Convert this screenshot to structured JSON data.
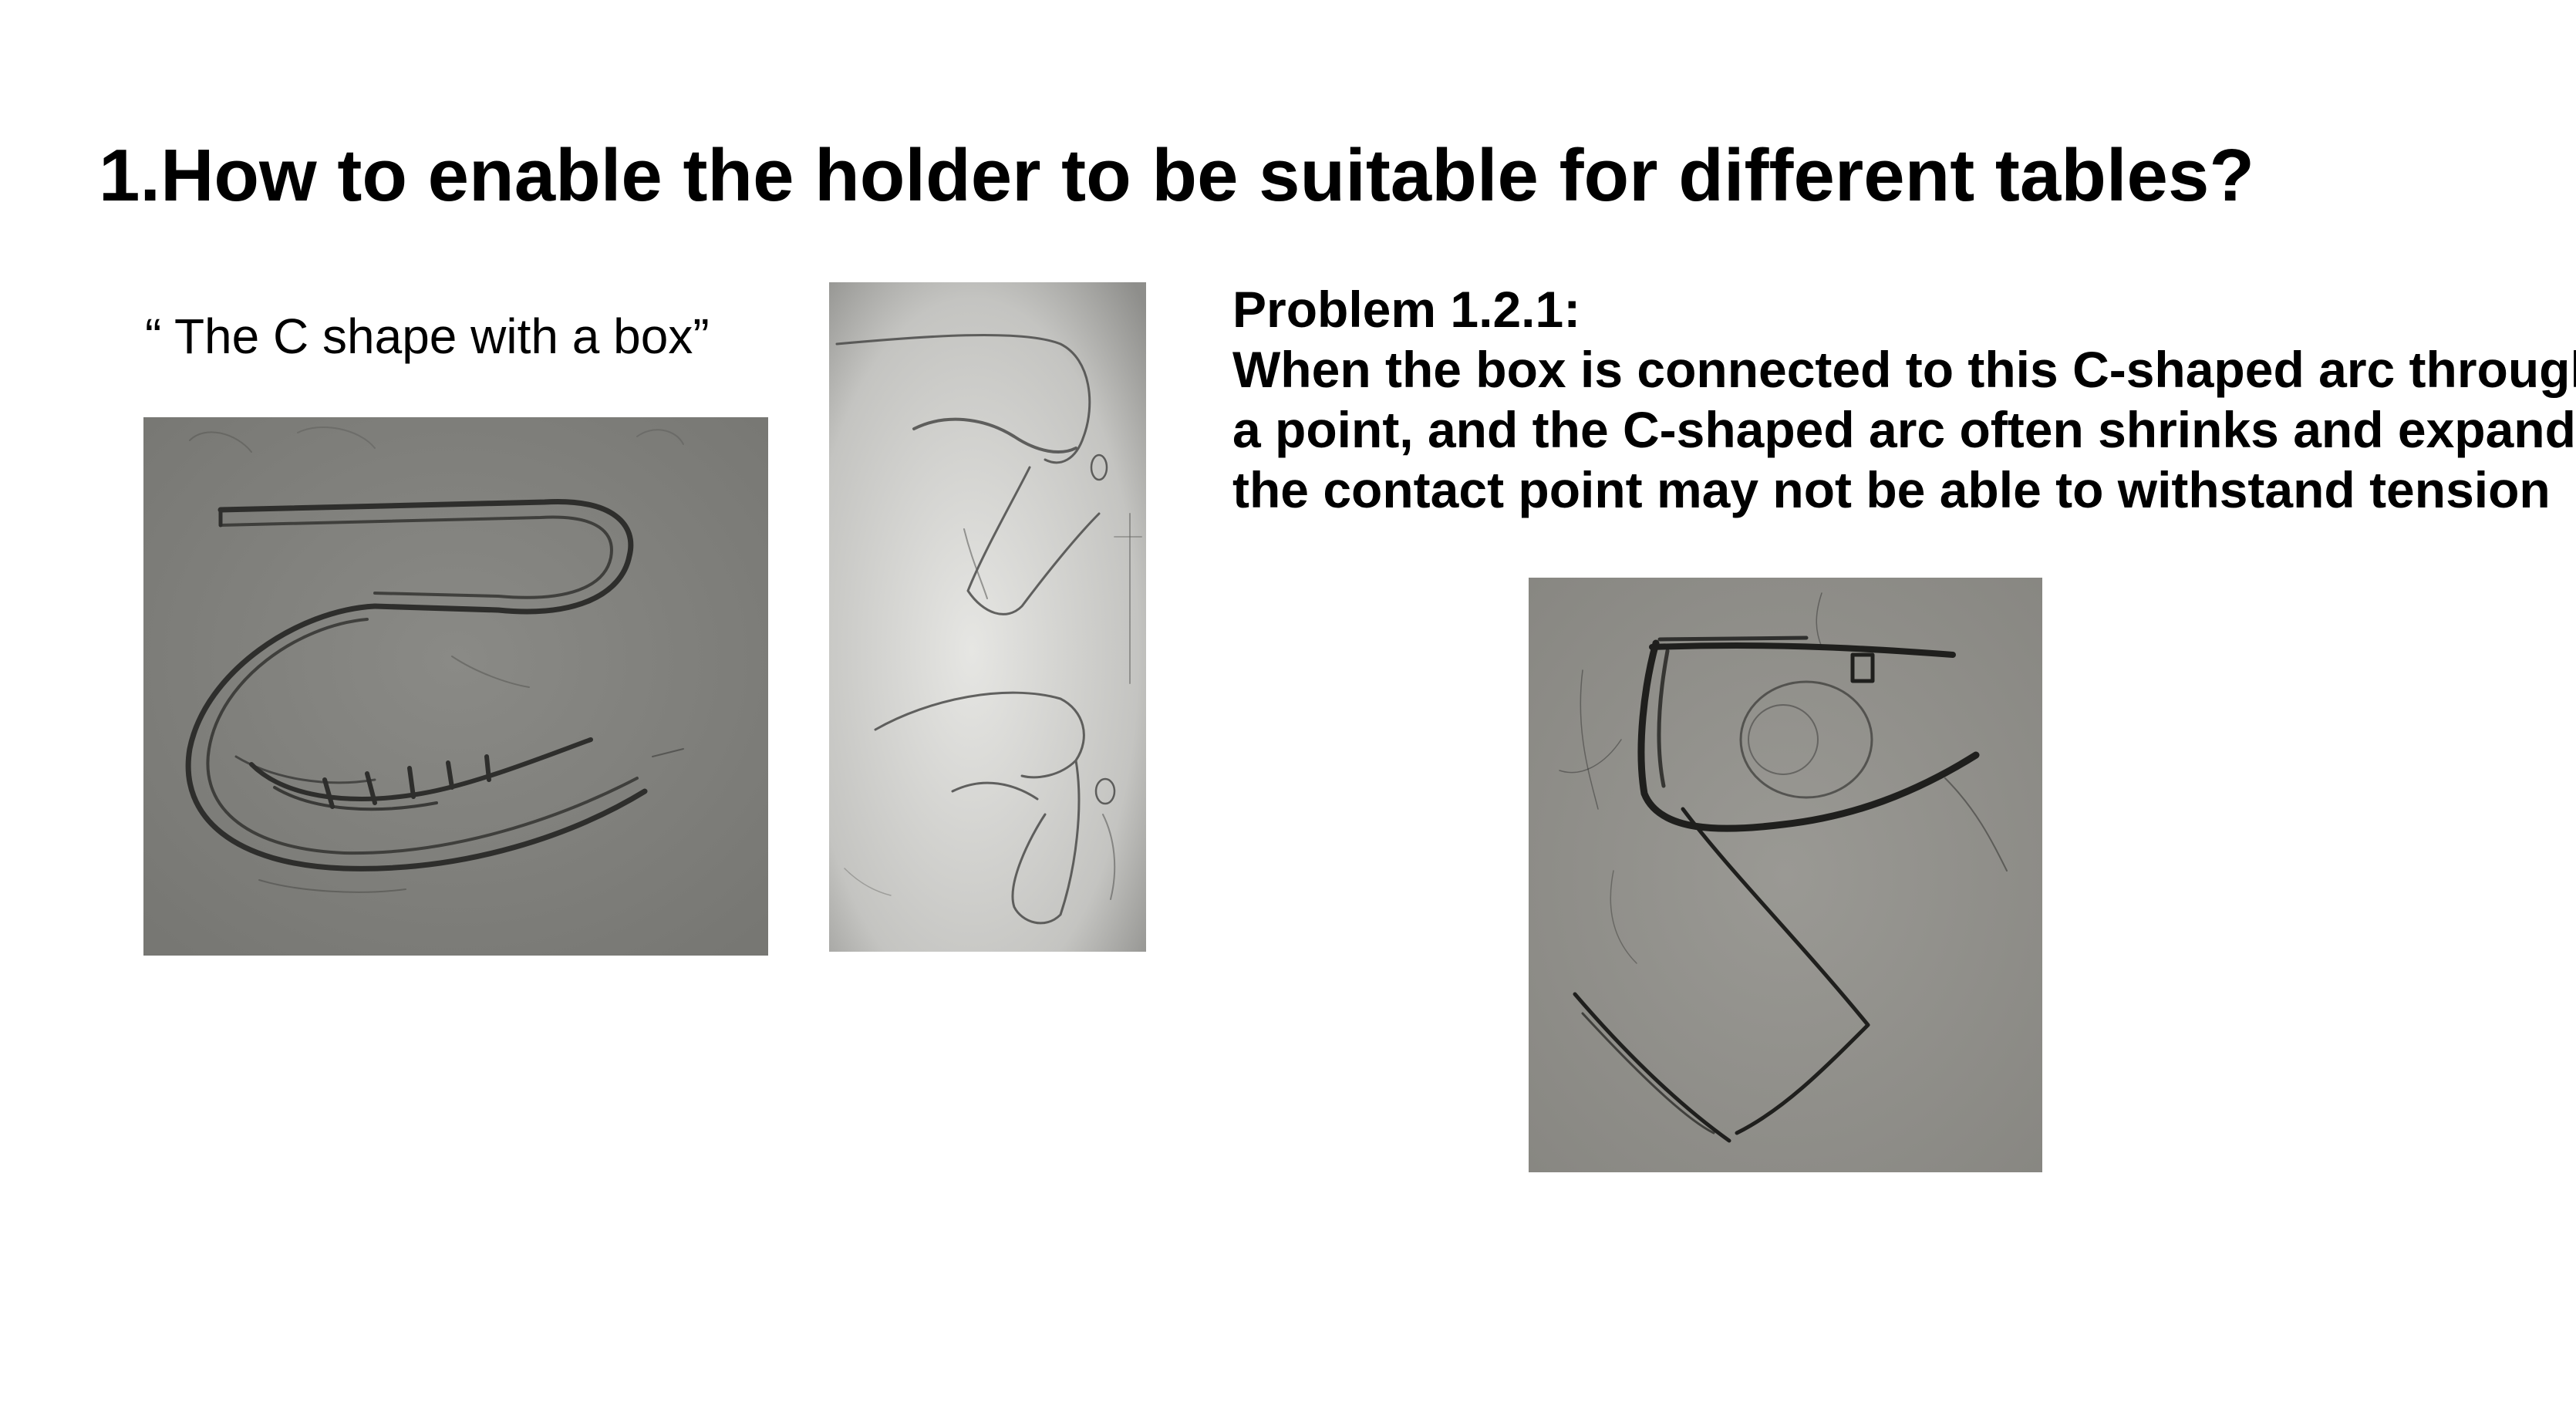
{
  "slide": {
    "title": "1.How to enable the holder to be suitable for different tables?",
    "caption": "“ The C shape with a box”",
    "problem": {
      "heading": "Problem 1.2.1:",
      "lines": [
        "When the box is connected to this C-shaped arc through",
        "a point, and the C-shaped arc often shrinks and expands,",
        "the contact point may not be able to withstand tension"
      ]
    }
  },
  "sketches": [
    {
      "icon": "pencil-sketch-c-shape-with-box",
      "colors": {
        "paper": "#7f7f7b",
        "pencil": "#2e2e2c"
      }
    },
    {
      "icon": "pencil-sketch-two-hook-variants",
      "colors": {
        "paper": "#c9c9c6",
        "pencil": "#4a4a48"
      }
    },
    {
      "icon": "pencil-sketch-clamp-arc",
      "colors": {
        "paper": "#8f8e89",
        "pencil": "#1f1f1d"
      }
    }
  ]
}
